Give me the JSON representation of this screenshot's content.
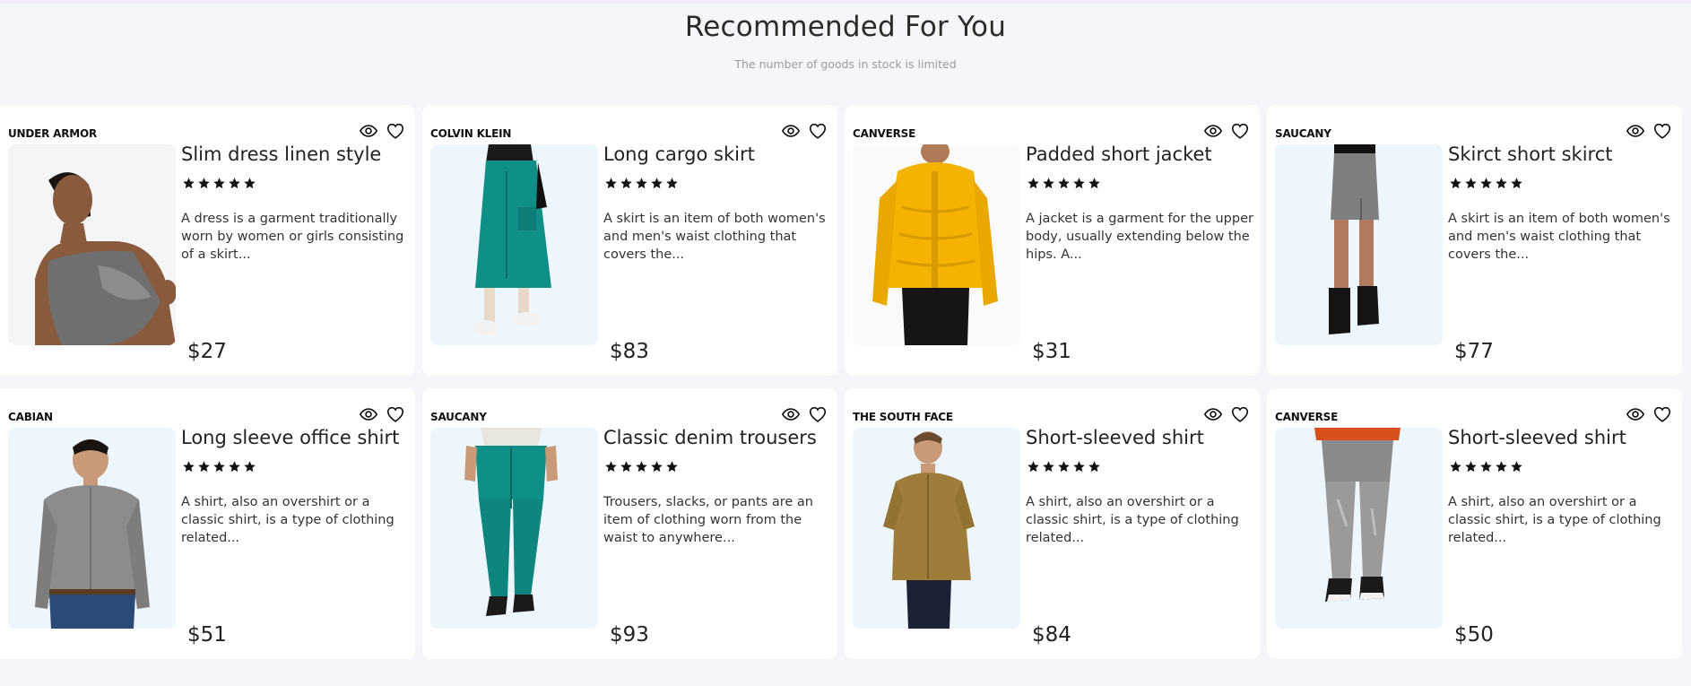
{
  "header": {
    "title": "Recommended For You",
    "subtitle": "The number of goods in stock is limited"
  },
  "icons": {
    "view": "eye-icon",
    "favorite": "heart-outline-icon",
    "rating": "star-icon"
  },
  "colors": {
    "image_bg": "#eef6fd",
    "page_bg": "#f4f6f9",
    "card_bg": "#ffffff"
  },
  "products": [
    {
      "brand": "UNDER ARMOR",
      "name": "Slim dress linen style",
      "rating": 5,
      "description": "A dress is a garment traditionally worn by women or girls consisting of a skirt...",
      "price": "$27",
      "image": "woman-in-grey-satin-dress"
    },
    {
      "brand": "COLVIN KLEIN",
      "name": "Long cargo skirt",
      "rating": 5,
      "description": "A skirt is an item of both women's and men's waist clothing that covers the...",
      "price": "$83",
      "image": "teal-cargo-skirt"
    },
    {
      "brand": "CANVERSE",
      "name": "Padded short jacket",
      "rating": 5,
      "description": "A jacket is a garment for the upper body, usually extending below the hips. A...",
      "price": "$31",
      "image": "yellow-puffer-jacket"
    },
    {
      "brand": "SAUCANY",
      "name": "Skirct short skirct",
      "rating": 5,
      "description": "A skirt is an item of both women's and men's waist clothing that covers the...",
      "price": "$77",
      "image": "grey-mini-skirt"
    },
    {
      "brand": "CABIAN",
      "name": "Long sleeve office shirt",
      "rating": 5,
      "description": "A shirt, also an overshirt or a classic shirt, is a type of clothing related...",
      "price": "$51",
      "image": "man-in-grey-shirt"
    },
    {
      "brand": "SAUCANY",
      "name": "Classic denim trousers",
      "rating": 5,
      "description": "Trousers, slacks, or pants are an item of clothing worn from the waist to anywhere...",
      "price": "$93",
      "image": "teal-trousers"
    },
    {
      "brand": "THE SOUTH FACE",
      "name": "Short-sleeved shirt",
      "rating": 5,
      "description": "A shirt, also an overshirt or a classic shirt, is a type of clothing related...",
      "price": "$84",
      "image": "man-in-olive-shirt"
    },
    {
      "brand": "CANVERSE",
      "name": "Short-sleeved shirt",
      "rating": 5,
      "description": "A shirt, also an overshirt or a classic shirt, is a type of clothing related...",
      "price": "$50",
      "image": "grey-jeans"
    }
  ]
}
